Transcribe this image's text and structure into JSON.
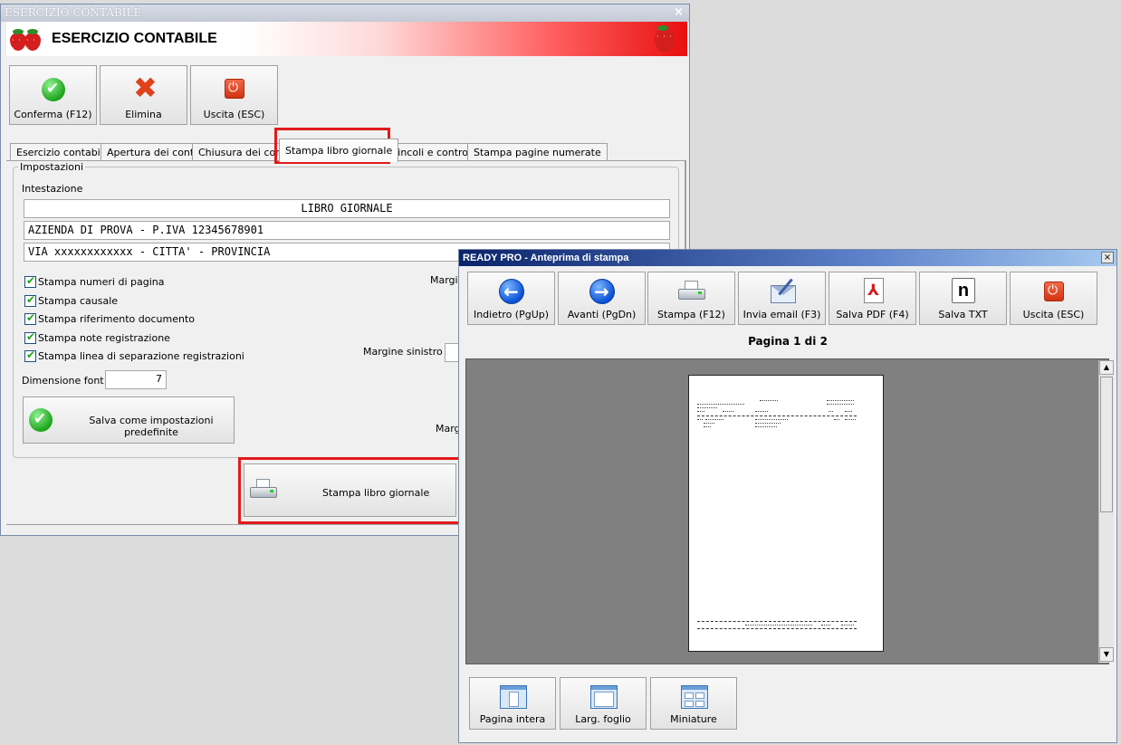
{
  "main_window": {
    "title": "ESERCIZIO CONTABILE",
    "header_title": "ESERCIZIO CONTABILE",
    "close_symbol": "×",
    "toolbar": {
      "confirm": "Conferma (F12)",
      "delete": "Elimina",
      "exit": "Uscita (ESC)"
    },
    "tabs": [
      {
        "label": "Esercizio contabile"
      },
      {
        "label": "Apertura dei conti"
      },
      {
        "label": "Chiusura dei cont"
      },
      {
        "label": "Stampa libro giornale",
        "active": true
      },
      {
        "label": "Vincoli e controlli"
      },
      {
        "label": "Stampa pagine numerate"
      }
    ],
    "settings": {
      "group_label": "Impostazioni",
      "header_label": "Intestazione",
      "header_lines": [
        "LIBRO GIORNALE",
        "AZIENDA DI PROVA - P.IVA 12345678901",
        "VIA xxxxxxxxxxxx - CITTA' - PROVINCIA"
      ],
      "checkboxes": [
        {
          "label": "Stampa numeri di pagina",
          "checked": true
        },
        {
          "label": "Stampa causale",
          "checked": true
        },
        {
          "label": "Stampa riferimento documento",
          "checked": true
        },
        {
          "label": "Stampa note registrazione",
          "checked": true
        },
        {
          "label": "Stampa linea di separazione registrazioni",
          "checked": true
        }
      ],
      "font_size_label": "Dimensione font :",
      "font_size_value": "7",
      "save_defaults_button": "Salva come impostazioni predefinite",
      "margin_top_label": "Margi",
      "margin_left_label": "Margine sinistro :",
      "margin_bottom_label": "Marg"
    },
    "print_button": "Stampa libro giornale"
  },
  "preview_window": {
    "title": "READY PRO - Anteprima di stampa",
    "close_symbol": "×",
    "toolbar": [
      {
        "label": "Indietro (PgUp)",
        "icon": "arrow-left-icon"
      },
      {
        "label": "Avanti (PgDn)",
        "icon": "arrow-right-icon"
      },
      {
        "label": "Stampa (F12)",
        "icon": "printer-icon"
      },
      {
        "label": "Invia email (F3)",
        "icon": "email-icon"
      },
      {
        "label": "Salva PDF (F4)",
        "icon": "pdf-icon"
      },
      {
        "label": "Salva TXT",
        "icon": "txt-icon",
        "glyph": "n"
      },
      {
        "label": "Uscita (ESC)",
        "icon": "exit-icon"
      }
    ],
    "page_indicator": "Pagina 1 di 2",
    "view_buttons": [
      {
        "label": "Pagina intera"
      },
      {
        "label": "Larg. foglio"
      },
      {
        "label": "Miniature"
      }
    ]
  },
  "colors": {
    "highlight": "#e21a1a",
    "preview_title_bar": "#0a246a",
    "preview_background": "#808080"
  }
}
